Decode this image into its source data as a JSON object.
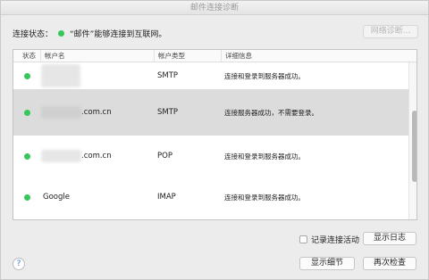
{
  "window": {
    "title": "邮件连接诊断"
  },
  "status": {
    "label": "连接状态：",
    "message": "“邮件”能够连接到互联网。",
    "indicator_color": "#35c759"
  },
  "network_diag_button": "网络诊断...",
  "table": {
    "columns": [
      "状态",
      "帐户名",
      "帐户类型",
      "详细信息"
    ],
    "rows": [
      {
        "status": "green",
        "account": "",
        "type": "SMTP",
        "detail": "连接和登录到服务器成功。"
      },
      {
        "status": "green",
        "account": ".com.cn",
        "type": "SMTP",
        "detail": "连接服务器成功，不需要登录。"
      },
      {
        "status": "green",
        "account": ".com.cn",
        "type": "POP",
        "detail": "连接和登录到服务器成功。"
      },
      {
        "status": "green",
        "account": "Google",
        "type": "IMAP",
        "detail": "连接和登录到服务器成功。"
      }
    ]
  },
  "log_checkbox_label": "记录连接活动",
  "show_log_button": "显示日志",
  "show_details_button": "显示细节",
  "recheck_button": "再次检查",
  "help_glyph": "?"
}
